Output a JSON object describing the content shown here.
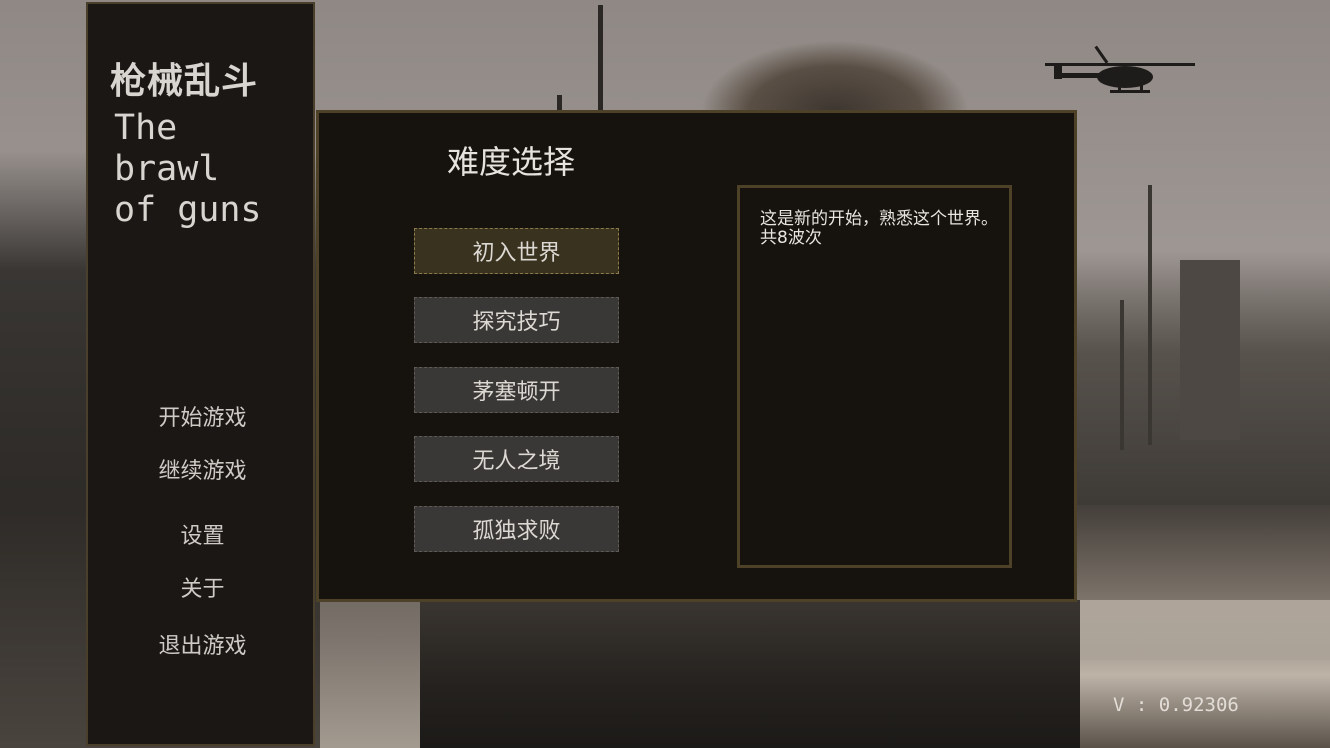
{
  "game": {
    "title_cn": "枪械乱斗",
    "title_en": "The\nbrawl\nof guns"
  },
  "menu": {
    "items": [
      {
        "label": "开始游戏"
      },
      {
        "label": "继续游戏"
      },
      {
        "label": "设置"
      },
      {
        "label": "关于"
      },
      {
        "label": "退出游戏"
      }
    ]
  },
  "difficulty": {
    "title": "难度选择",
    "options": [
      {
        "label": "初入世界",
        "selected": true
      },
      {
        "label": "探究技巧",
        "selected": false
      },
      {
        "label": "茅塞顿开",
        "selected": false
      },
      {
        "label": "无人之境",
        "selected": false
      },
      {
        "label": "孤独求败",
        "selected": false
      }
    ],
    "description": "这是新的开始，熟悉这个世界。共8波次"
  },
  "version": "V : 0.92306",
  "colors": {
    "panel_bg": "#16130f",
    "panel_border": "#4d4128",
    "button_bg": "#3a3836",
    "selected_bg": "#39321f",
    "text": "#dcd8d3"
  }
}
